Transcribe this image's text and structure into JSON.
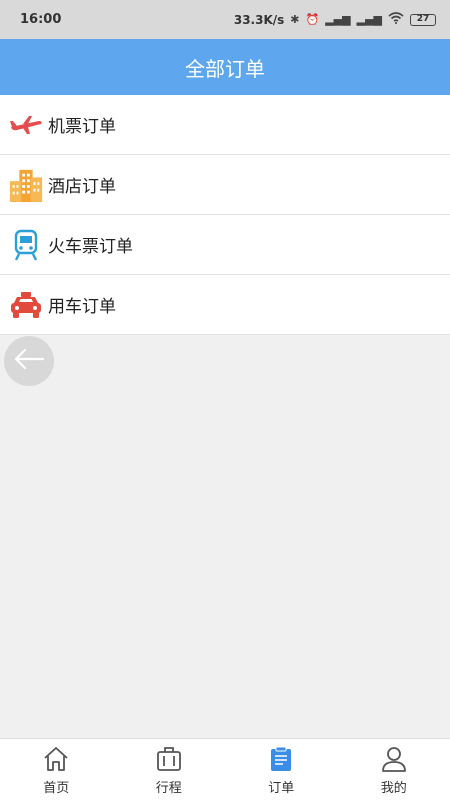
{
  "status_bar": {
    "time": "16:00",
    "speed": "33.3K/s",
    "battery": "27"
  },
  "header": {
    "title": "全部订单"
  },
  "orders": [
    {
      "label": "机票订单",
      "icon": "airplane-icon"
    },
    {
      "label": "酒店订单",
      "icon": "hotel-building-icon"
    },
    {
      "label": "火车票订单",
      "icon": "train-icon"
    },
    {
      "label": "用车订单",
      "icon": "car-icon"
    }
  ],
  "tabbar": {
    "items": [
      {
        "label": "首页",
        "icon": "home-icon"
      },
      {
        "label": "行程",
        "icon": "luggage-icon"
      },
      {
        "label": "订单",
        "icon": "order-clipboard-icon",
        "active": true
      },
      {
        "label": "我的",
        "icon": "user-icon"
      }
    ]
  },
  "colors": {
    "accent": "#5ea6ed",
    "tab_active": "#3a8ee6"
  }
}
